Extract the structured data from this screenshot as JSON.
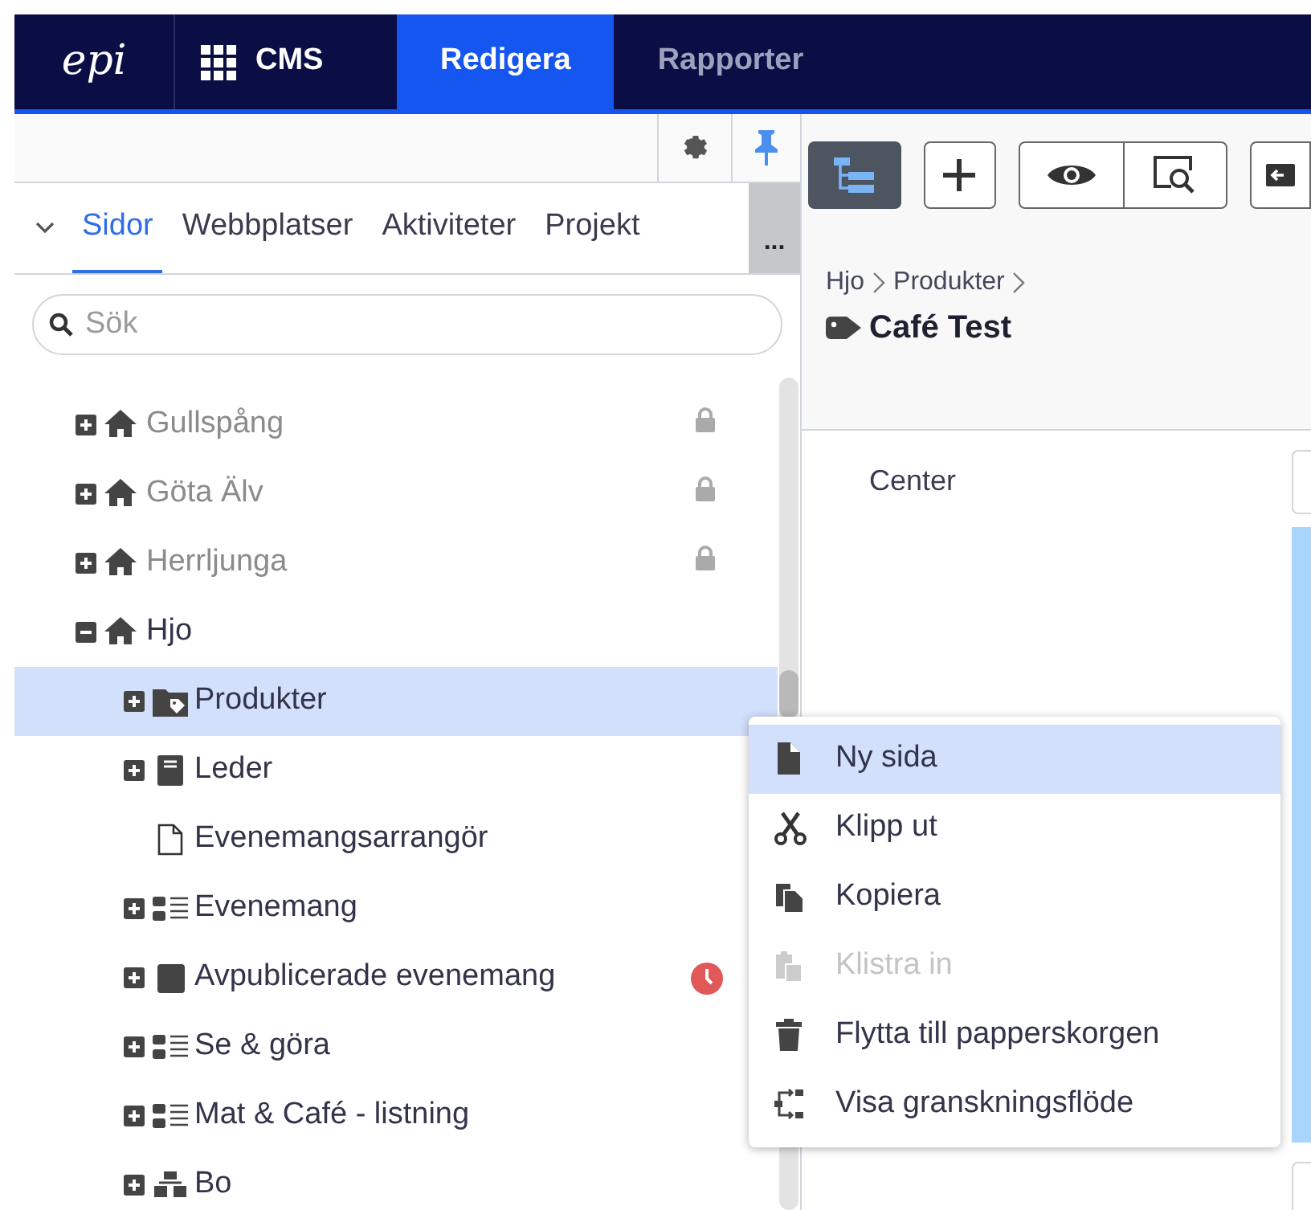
{
  "topbar": {
    "logo": "epi",
    "product": "CMS",
    "tabs": [
      {
        "label": "Redigera",
        "selected": true
      },
      {
        "label": "Rapporter",
        "selected": false
      }
    ]
  },
  "panel": {
    "tabs": [
      {
        "label": "Sidor",
        "selected": true
      },
      {
        "label": "Webbplatser",
        "selected": false
      },
      {
        "label": "Aktiviteter",
        "selected": false
      },
      {
        "label": "Projekt",
        "selected": false
      }
    ],
    "more": "...",
    "search": {
      "placeholder": "Sök"
    },
    "tree": [
      {
        "label": "Gullspång",
        "kind": "home",
        "locked": true,
        "expanded": false,
        "selected": false
      },
      {
        "label": "Göta Älv",
        "kind": "home",
        "locked": true,
        "expanded": false,
        "selected": false
      },
      {
        "label": "Herrljunga",
        "kind": "home",
        "locked": true,
        "expanded": false,
        "selected": false
      },
      {
        "label": "Hjo",
        "kind": "home",
        "locked": false,
        "expanded": true,
        "selected": false,
        "children": [
          {
            "label": "Produkter",
            "kind": "tag-folder",
            "locked": false,
            "expanded": false,
            "selected": true
          },
          {
            "label": "Leder",
            "kind": "book",
            "locked": false,
            "expanded": false,
            "selected": false
          },
          {
            "label": "Evenemangsarrangör",
            "kind": "page",
            "locked": false,
            "selected": false
          },
          {
            "label": "Evenemang",
            "kind": "list",
            "locked": false,
            "expanded": false,
            "selected": false
          },
          {
            "label": "Avpublicerade evenemang",
            "kind": "container",
            "locked": false,
            "expanded": false,
            "selected": false,
            "expired": true
          },
          {
            "label": "Se & göra",
            "kind": "list",
            "locked": false,
            "expanded": false,
            "selected": false
          },
          {
            "label": "Mat & Café - listning",
            "kind": "list",
            "locked": false,
            "expanded": false,
            "selected": false
          },
          {
            "label": "Bo",
            "kind": "structure",
            "locked": false,
            "expanded": false,
            "selected": false
          }
        ]
      }
    ]
  },
  "context_menu": [
    {
      "label": "Ny sida",
      "kind": "page",
      "disabled": false,
      "selected": true
    },
    {
      "label": "Klipp ut",
      "kind": "cut",
      "disabled": false,
      "selected": false
    },
    {
      "label": "Kopiera",
      "kind": "copy",
      "disabled": false,
      "selected": false
    },
    {
      "label": "Klistra in",
      "kind": "paste",
      "disabled": true,
      "selected": false
    },
    {
      "label": "Flytta till papperskorgen",
      "kind": "trash",
      "disabled": false,
      "selected": false
    },
    {
      "label": "Visa granskningsflöde",
      "kind": "flow",
      "disabled": false,
      "selected": false
    }
  ],
  "editor": {
    "breadcrumb": [
      "Hjo",
      "Produkter"
    ],
    "title": "Café Test",
    "field_label": "Center"
  }
}
